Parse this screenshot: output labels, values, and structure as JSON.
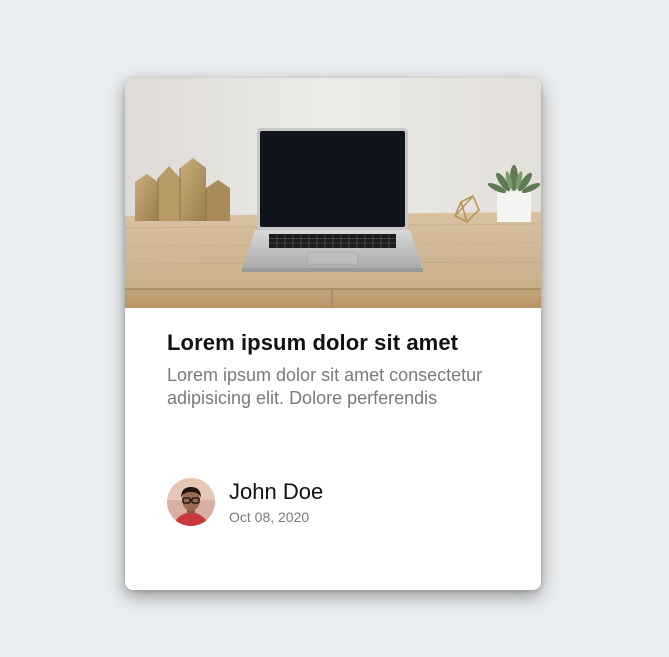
{
  "card": {
    "title": "Lorem ipsum dolor sit amet",
    "description": "Lorem ipsum dolor sit amet consectetur adipisicing elit. Dolore perferendis",
    "author": {
      "name": "John Doe",
      "date": "Oct 08, 2020"
    }
  },
  "colors": {
    "page_background": "#ebeef0",
    "card_background": "#ffffff",
    "title_text": "#111111",
    "muted_text": "#7a7a7a"
  },
  "icons": {
    "image": "laptop-desk-photo",
    "avatar": "user-avatar-photo"
  }
}
